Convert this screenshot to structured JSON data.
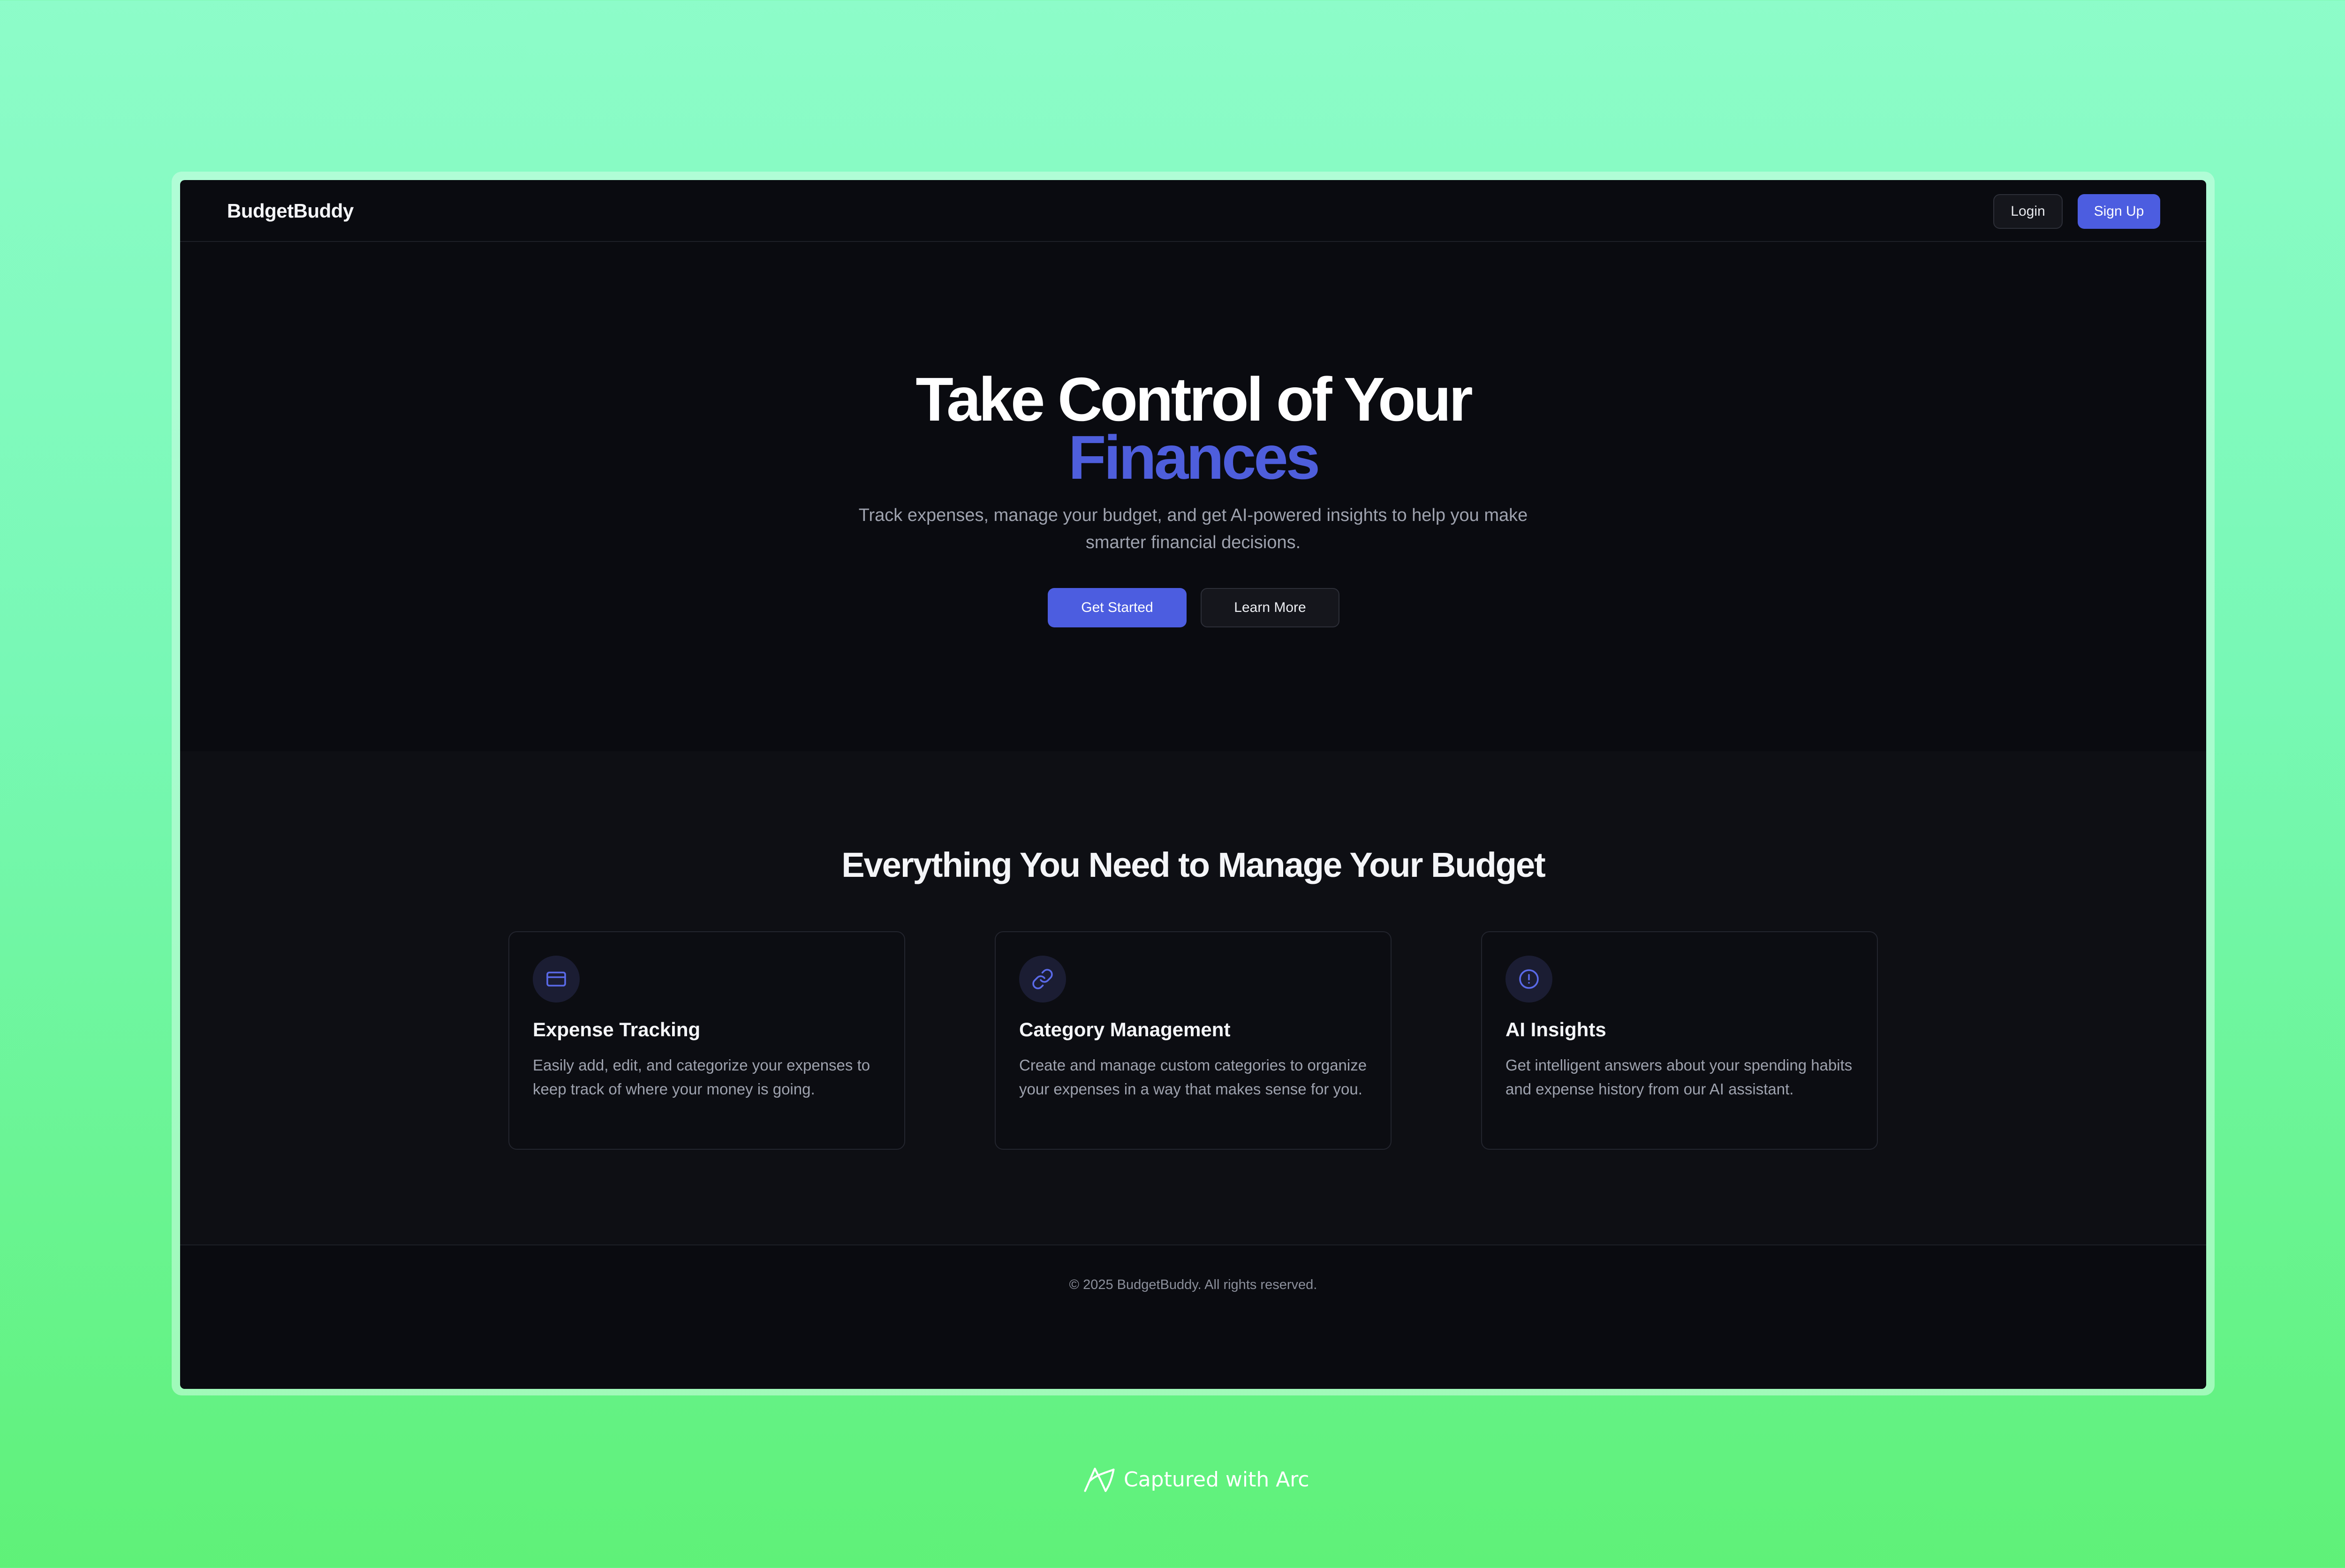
{
  "nav": {
    "brand": "BudgetBuddy",
    "login_label": "Login",
    "signup_label": "Sign Up"
  },
  "hero": {
    "title_line1": "Take Control of Your",
    "title_line2": "Finances",
    "subtitle": "Track expenses, manage your budget, and get AI-powered insights to help you make smarter financial decisions.",
    "primary_cta": "Get Started",
    "secondary_cta": "Learn More"
  },
  "features": {
    "title": "Everything You Need to Manage Your Budget",
    "cards": [
      {
        "icon": "credit-card-icon",
        "title": "Expense Tracking",
        "description": "Easily add, edit, and categorize your expenses to keep track of where your money is going."
      },
      {
        "icon": "link-icon",
        "title": "Category Management",
        "description": "Create and manage custom categories to organize your expenses in a way that makes sense for you."
      },
      {
        "icon": "alert-circle-icon",
        "title": "AI Insights",
        "description": "Get intelligent answers about your spending habits and expense history from our AI assistant."
      }
    ]
  },
  "footer": {
    "copyright": "© 2025 BudgetBuddy. All rights reserved."
  },
  "capture_badge": {
    "label": "Captured with Arc",
    "icon": "arc-logo-icon"
  },
  "colors": {
    "accent": "#4c5de0",
    "background": "#0a0b10",
    "features_background": "#0e0f14",
    "text_primary": "#f4f5f8",
    "text_muted": "#9ea2ae"
  }
}
